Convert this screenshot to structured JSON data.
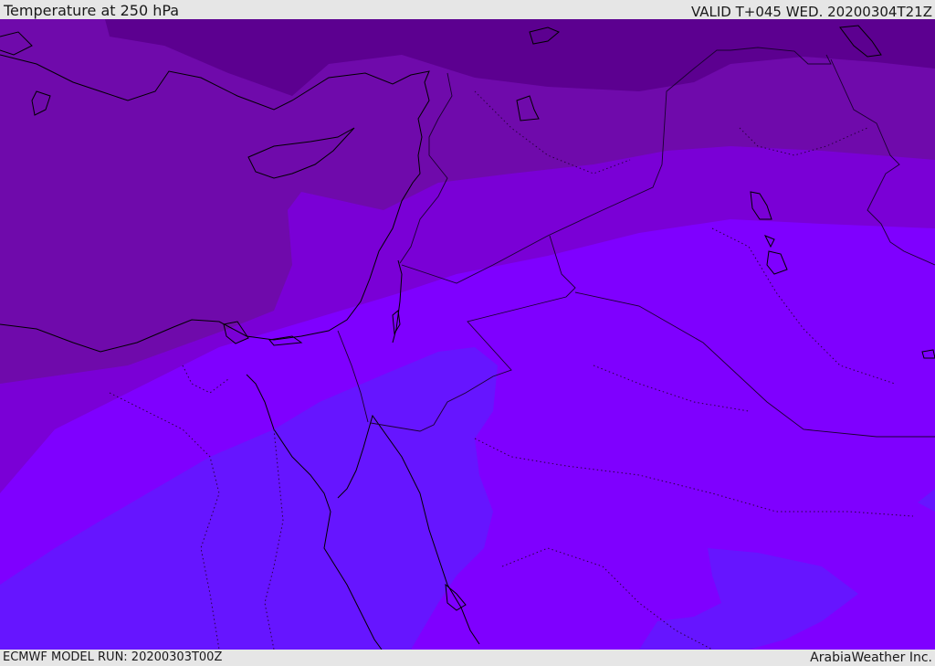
{
  "header": {
    "title": "Temperature at 250 hPa",
    "valid": "VALID T+045 WED. 20200304T21Z"
  },
  "footer": {
    "model_run": "ECMWF MODEL RUN: 20200303T00Z",
    "credit": "ArabiaWeather Inc."
  },
  "colors": {
    "band_coldest": "#5c0090",
    "band_cold": "#6f0aab",
    "band_mid": "#7a00d6",
    "band_warm": "#7f00ff",
    "band_warmest": "#6615ff",
    "coast": "#000000",
    "borders": "#2a0040"
  }
}
